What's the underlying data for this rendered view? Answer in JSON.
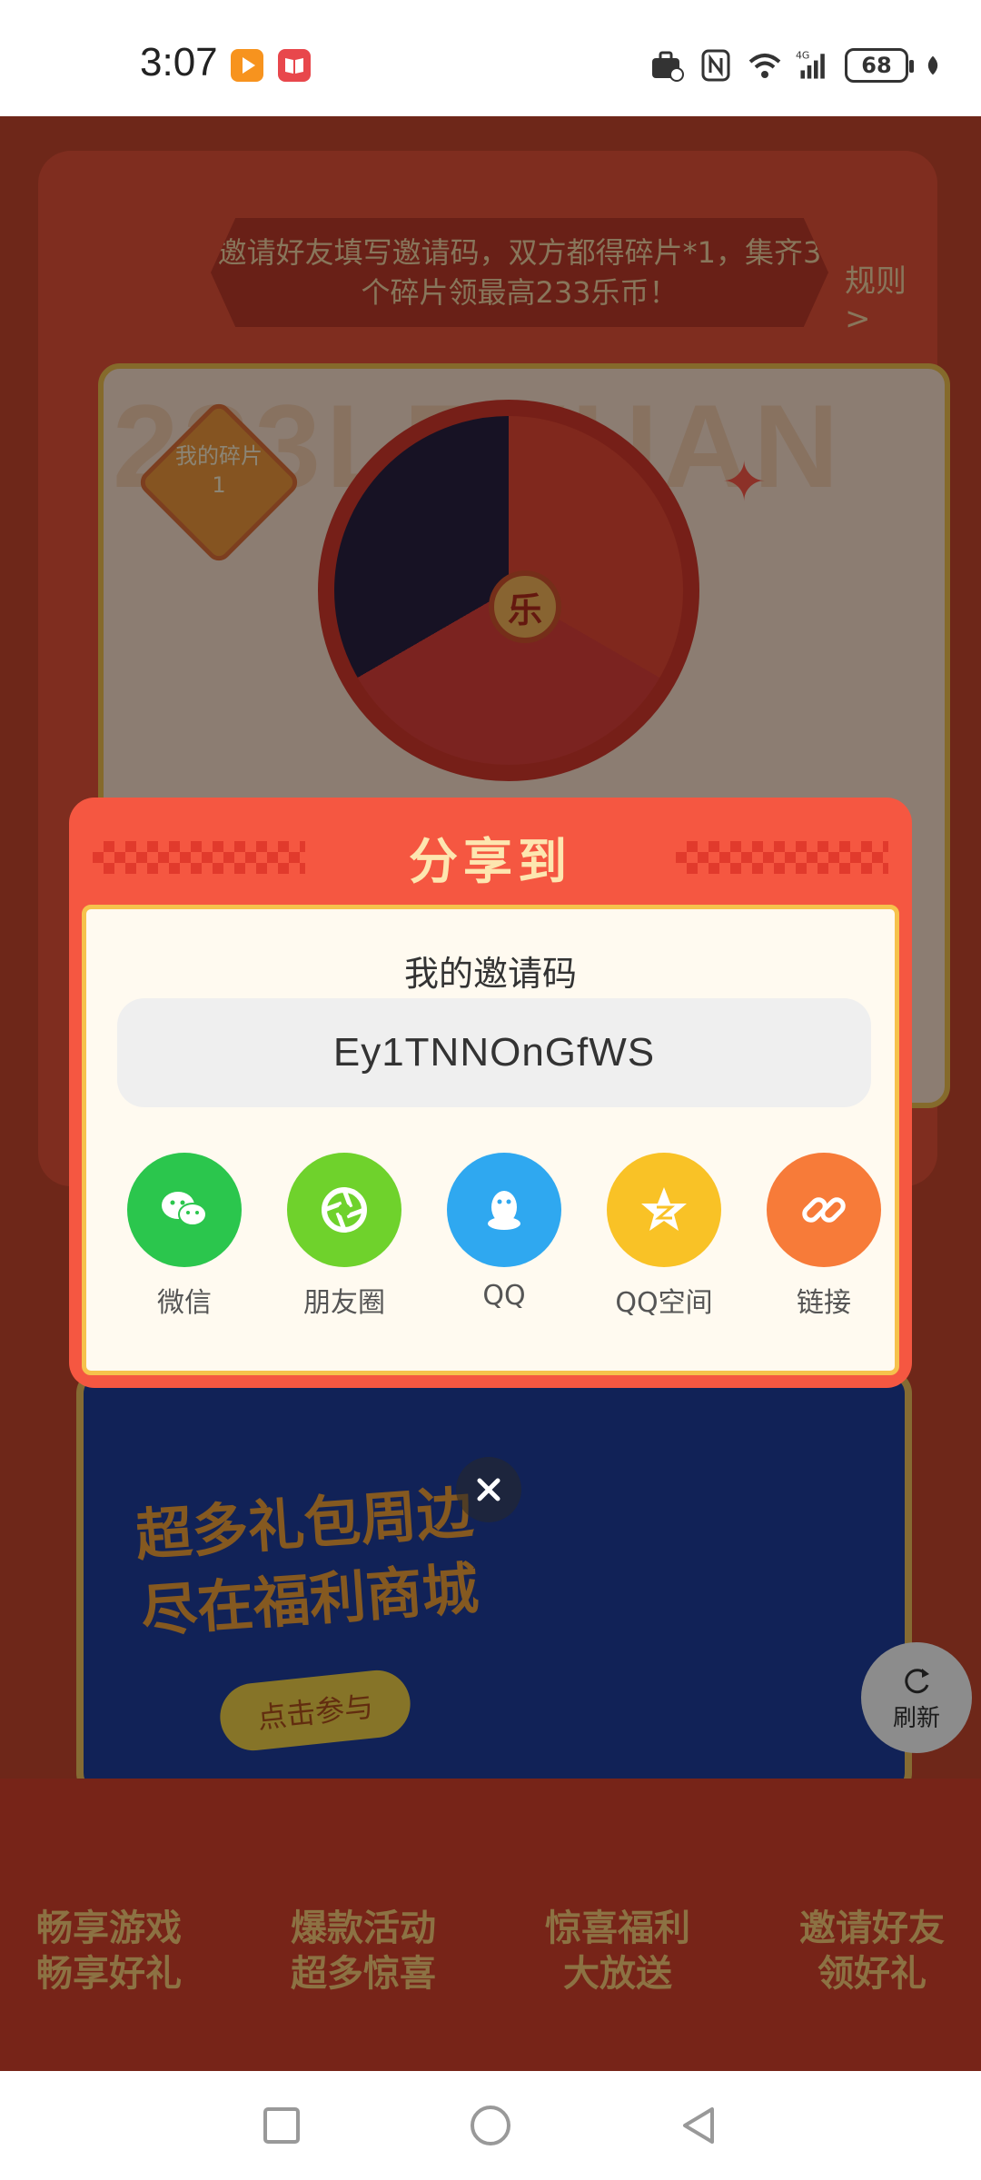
{
  "status_bar": {
    "time": "3:07",
    "battery": "68",
    "network": "4G"
  },
  "background": {
    "invite_banner": "邀请好友填写邀请码，双方都得碎片*1，集齐3个碎片领最高233乐币！",
    "rules_link": "规则 >",
    "watermark": "233LEYUAN",
    "fragment_badge": {
      "label": "我的碎片",
      "count": "1"
    },
    "wheel_hub": "乐",
    "mall_banner": {
      "title_line1": "超多礼包周边",
      "title_line2": "尽在福利商城",
      "button": "点击参与"
    },
    "refresh": "刷新",
    "features": [
      {
        "line1": "畅享游戏",
        "line2": "畅享好礼"
      },
      {
        "line1": "爆款活动",
        "line2": "超多惊喜"
      },
      {
        "line1": "惊喜福利",
        "line2": "大放送"
      },
      {
        "line1": "邀请好友",
        "line2": "领好礼"
      }
    ]
  },
  "dialog": {
    "title": "分享到",
    "invite_label": "我的邀请码",
    "invite_code": "Ey1TNNOnGfWS",
    "share_targets": [
      {
        "label": "微信",
        "icon": "wechat-icon",
        "color": "#2bc64d"
      },
      {
        "label": "朋友圈",
        "icon": "moments-icon",
        "color": "#6fd22c"
      },
      {
        "label": "QQ",
        "icon": "qq-icon",
        "color": "#2fa8f0"
      },
      {
        "label": "QQ空间",
        "icon": "qzone-icon",
        "color": "#f9c226"
      },
      {
        "label": "链接",
        "icon": "link-icon",
        "color": "#f77b39"
      }
    ]
  },
  "colors": {
    "dialog_bg": "#f55741",
    "dialog_inner": "#fffaf0",
    "title": "#fde6b0"
  }
}
